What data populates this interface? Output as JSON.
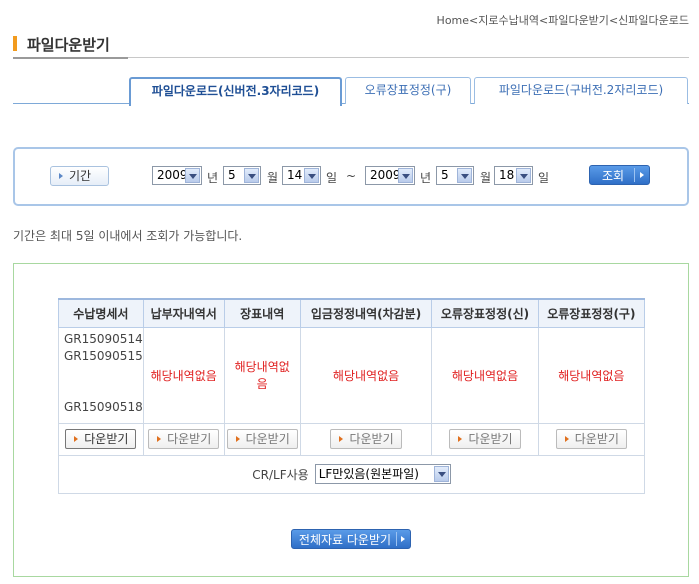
{
  "breadcrumb": {
    "items": [
      "Home",
      "지로수납내역",
      "파일다운받기",
      "신파일다운로드"
    ],
    "separator": "<"
  },
  "page": {
    "title": "파일다운받기"
  },
  "tabs": [
    {
      "label": "파일다운로드(신버전.3자리코드)",
      "active": true
    },
    {
      "label": "오류장표정정(구)",
      "active": false
    },
    {
      "label": "파일다운로드(구버전.2자리코드)",
      "active": false
    }
  ],
  "search": {
    "period_label": "기간",
    "from": {
      "year": "2009",
      "month": "5",
      "day": "14"
    },
    "to": {
      "year": "2009",
      "month": "5",
      "day": "18"
    },
    "unit_year": "년",
    "unit_month": "월",
    "unit_day": "일",
    "range_sep": "~",
    "query_button": "조회"
  },
  "notice": "기간은 최대 5일 이내에서 조회가 가능합니다.",
  "table": {
    "headers": [
      "수납명세서",
      "납부자내역서",
      "장표내역",
      "입금정정내역(차감분)",
      "오류장표정정(신)",
      "오류장표정정(구)"
    ],
    "codes": [
      "GR15090514",
      "GR15090515",
      "",
      "",
      "GR15090518"
    ],
    "none_text": "해당내역없음",
    "download_label": "다운받기"
  },
  "crlf": {
    "label": "CR/LF사용",
    "selected": "LF만있음(원본파일)"
  },
  "download_all_button": "전체자료 다운받기",
  "colors": {
    "accent_orange": "#f29b1e",
    "link_blue": "#3d6fb5",
    "none_red": "#e02020",
    "button_blue": "#2f6fc7"
  }
}
